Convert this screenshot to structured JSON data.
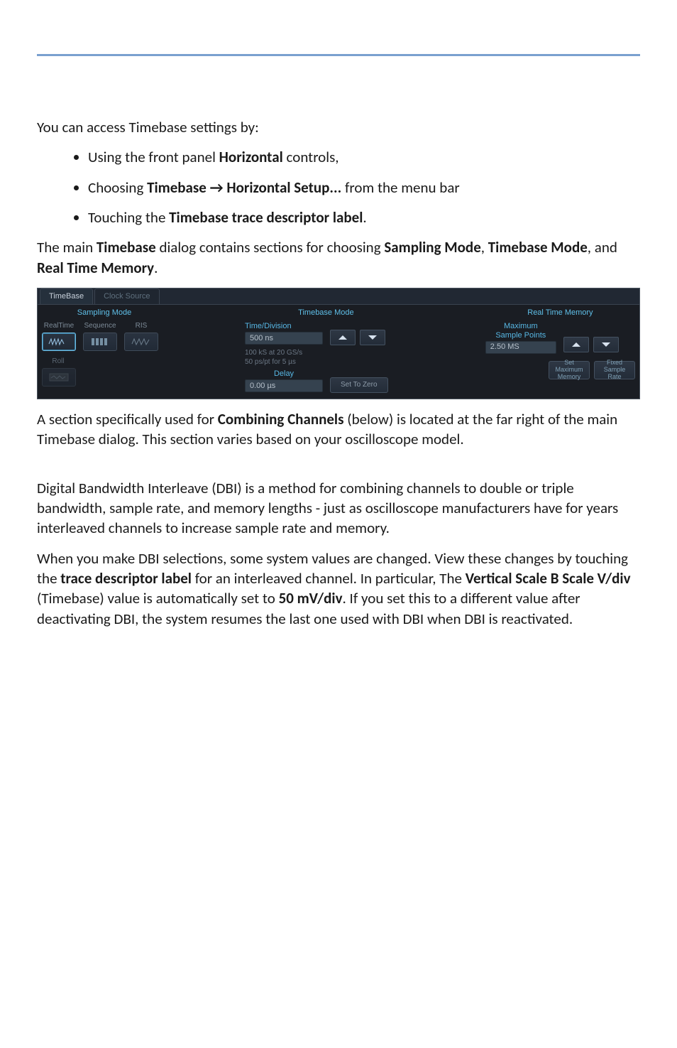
{
  "intro": "You can access Timebase settings by:",
  "bullets": [
    {
      "pre": "Using the front panel ",
      "bold": "Horizontal",
      "post": " controls,"
    },
    {
      "pre": "Choosing ",
      "bold": "Timebase → Horizontal Setup...",
      "post": " from the menu bar"
    },
    {
      "pre": "Touching the ",
      "bold": "Timebase trace descriptor label",
      "post": "."
    }
  ],
  "para2": {
    "t1": "The main ",
    "b1": "Timebase",
    "t2": " dialog contains sections for choosing ",
    "b2": "Sampling Mode",
    "t3": ", ",
    "b3": "Timebase Mode",
    "t4": ", and ",
    "b4": "Real Time Memory",
    "t5": "."
  },
  "para3": {
    "t1": "A section specifically used for ",
    "b1": "Combining Channels",
    "t2": " (below) is located at the far right of the main Timebase dialog. This section varies based on your oscilloscope model."
  },
  "para4": "Digital Bandwidth Interleave (DBI) is a method for combining channels to double or triple bandwidth, sample rate, and memory lengths - just as oscilloscope manufacturers have for years interleaved channels to increase sample rate and memory.",
  "para5": {
    "t1": "When you make DBI selections, some system values are changed. View these changes by touching the ",
    "b1": "trace descriptor label",
    "t2": " for an interleaved channel. In particular, The ",
    "b2": "Vertical Scale B Scale V/div",
    "t3": " (Timebase) value is automatically set to ",
    "b3": "50 mV/div",
    "t4": ". If you set this to a different value after deactivating DBI, the system resumes the last one used with DBI when DBI is reactivated."
  },
  "shot": {
    "tabs": [
      "TimeBase",
      "Clock Source"
    ],
    "sampling": {
      "title": "Sampling Mode",
      "realTime": "RealTime",
      "sequence": "Sequence",
      "ris": "RIS",
      "roll": "Roll"
    },
    "timebase": {
      "title": "Timebase Mode",
      "timeDivLabel": "Time/Division",
      "timeDivValue": "500 ns",
      "status1": "100 kS at 20 GS/s",
      "status2": "50 ps/pt for 5 µs",
      "delayLabel": "Delay",
      "delayValue": "0.00 µs",
      "setToZero": "Set To Zero"
    },
    "memory": {
      "title": "Real Time Memory",
      "maxLabel1": "Maximum",
      "maxLabel2": "Sample Points",
      "maxValue": "2.50 MS",
      "setMax1": "Set",
      "setMax2": "Maximum",
      "setMax3": "Memory",
      "fixed1": "Fixed",
      "fixed2": "Sample",
      "fixed3": "Rate"
    }
  }
}
